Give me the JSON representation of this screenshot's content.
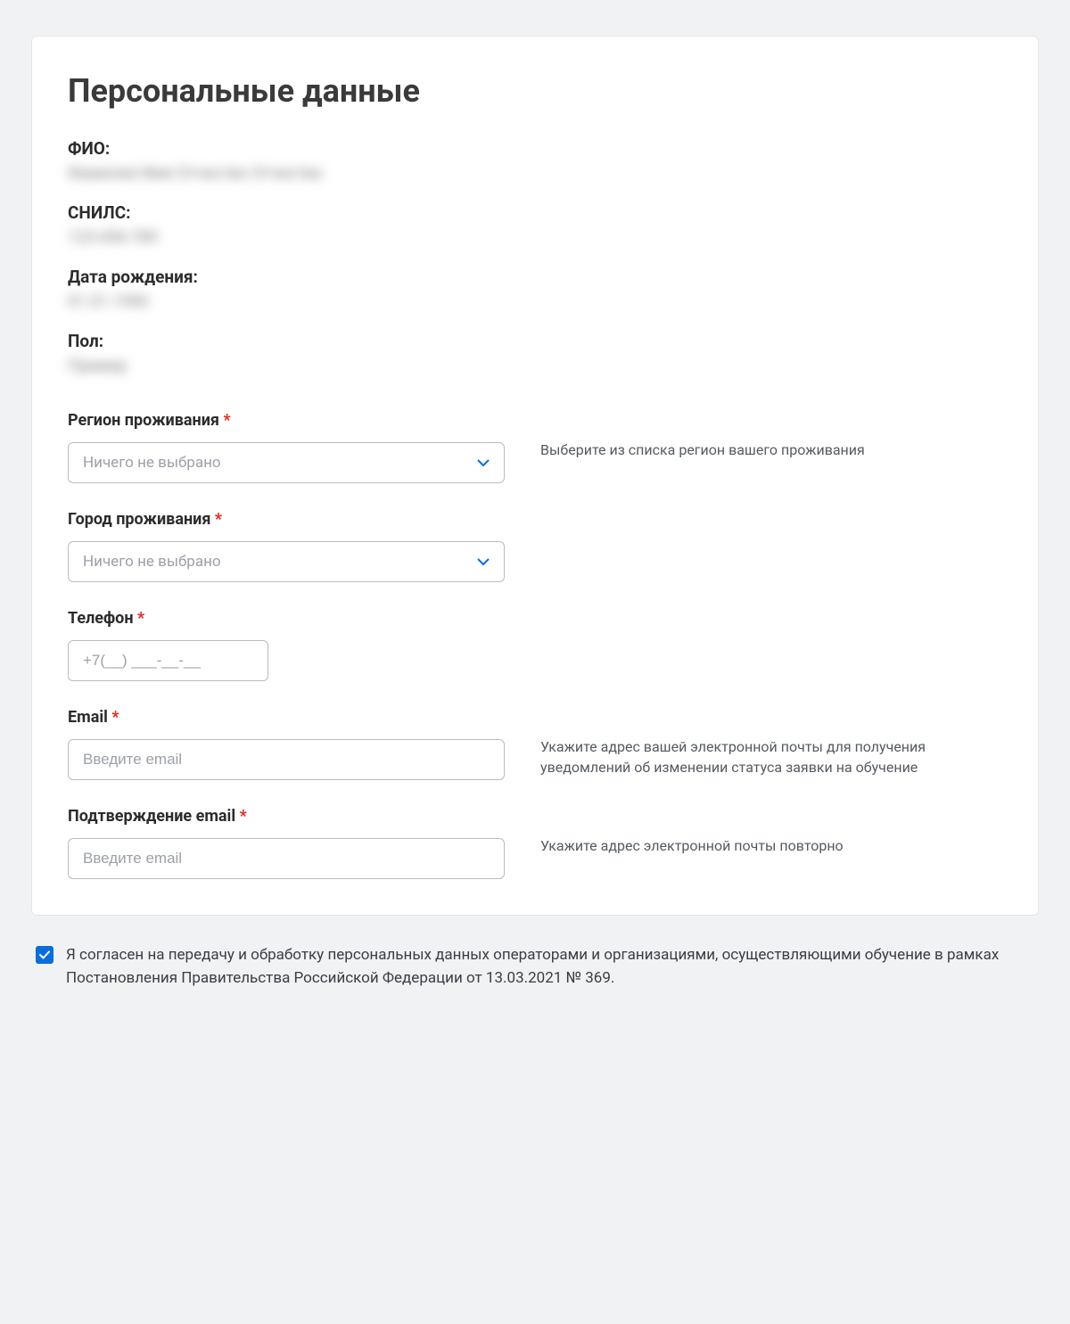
{
  "title": "Персональные данные",
  "static_fields": {
    "fullname": {
      "label": "ФИО:",
      "value": "Фамилия Имя Отчество Отчество"
    },
    "snils": {
      "label": "СНИЛС:",
      "value": "123-456-789"
    },
    "birthdate": {
      "label": "Дата рождения:",
      "value": "01.01.1990"
    },
    "gender": {
      "label": "Пол:",
      "value": "Пример"
    }
  },
  "form": {
    "region": {
      "label": "Регион проживания",
      "placeholder": "Ничего не выбрано",
      "helper": "Выберите из списка регион вашего проживания"
    },
    "city": {
      "label": "Город проживания",
      "placeholder": "Ничего не выбрано"
    },
    "phone": {
      "label": "Телефон",
      "placeholder": "+7(__) ___-__-__"
    },
    "email": {
      "label": "Email",
      "placeholder": "Введите email",
      "helper": "Укажите адрес вашей электронной почты для получения уведомлений об изменении статуса заявки на обучение"
    },
    "email_confirm": {
      "label": "Подтверждение email",
      "placeholder": "Введите email",
      "helper": "Укажите адрес электронной почты повторно"
    }
  },
  "consent": {
    "text": "Я согласен на передачу и обработку персональных данных операторами и организациями, осуществляющими обучение в рамках Постановления Правительства Российской Федерации от 13.03.2021 № 369.",
    "checked": true
  },
  "asterisk": "*"
}
